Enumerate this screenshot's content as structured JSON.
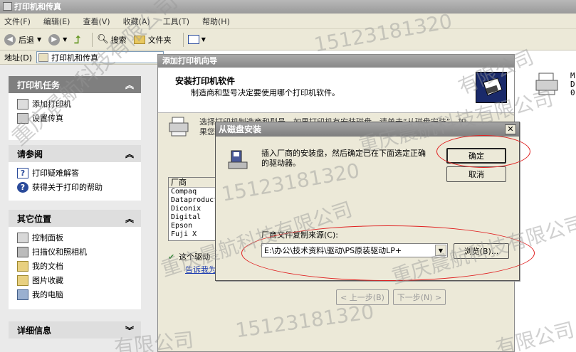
{
  "window": {
    "title": "打印机和传真"
  },
  "menubar": [
    "文件(F)",
    "编辑(E)",
    "查看(V)",
    "收藏(A)",
    "工具(T)",
    "帮助(H)"
  ],
  "toolbar": {
    "back": "后退",
    "search": "搜索",
    "folders": "文件夹"
  },
  "address": {
    "label": "地址(D)",
    "value": "打印机和传真"
  },
  "printer_tasks": {
    "title": "打印机任务",
    "items": [
      "添加打印机",
      "设置传真"
    ]
  },
  "see_also": {
    "title": "请参阅",
    "items": [
      "打印疑难解答",
      "获得关于打印的帮助"
    ]
  },
  "other_places": {
    "title": "其它位置",
    "items": [
      "控制面板",
      "扫描仪和照相机",
      "我的文档",
      "图片收藏",
      "我的电脑"
    ]
  },
  "details": {
    "title": "详细信息"
  },
  "wizard": {
    "title": "添加打印机向导",
    "heading": "安装打印机软件",
    "subheading": "制造商和型号决定要使用哪个打印机软件。",
    "instruction_line1": "选择打印机制造商和型号。如果打印机有安装磁盘，请单击“从磁盘安装”。如",
    "instruction_line2": "果您",
    "mfg_header": "厂商",
    "manufacturers": [
      "Compaq",
      "Dataproducts",
      "Diconix",
      "Digital",
      "Epson",
      "Fuji X"
    ],
    "driver_note": "这个驱动",
    "driver_link": "告诉我为什么驱动程序签名很重要",
    "back_button": "< 上一步(B)",
    "next_button": "下一步(N) >"
  },
  "dialog": {
    "title": "从磁盘安装",
    "message_line1": "插入厂商的安装盘，然后确定已在下面选定正确",
    "message_line2": "的驱动器。",
    "ok_button": "确定",
    "cancel_button": "取消",
    "copy_from_label": "厂商文件复制来源(C):",
    "copy_from_value": "E:\\办公\\技术资料\\驱动\\PS原装驱动LP+",
    "browse_button": "浏览(B)..."
  },
  "right_pane": {
    "item_line1": "M",
    "item_line2": "D",
    "item_line3": "0"
  },
  "watermark": {
    "phone": "15123181320",
    "company_a": "重庆晨航科技有限公司",
    "company_b": "有限公司"
  },
  "colors": {
    "annotation": "#e02020",
    "title_bar": "#9a9a9a"
  }
}
